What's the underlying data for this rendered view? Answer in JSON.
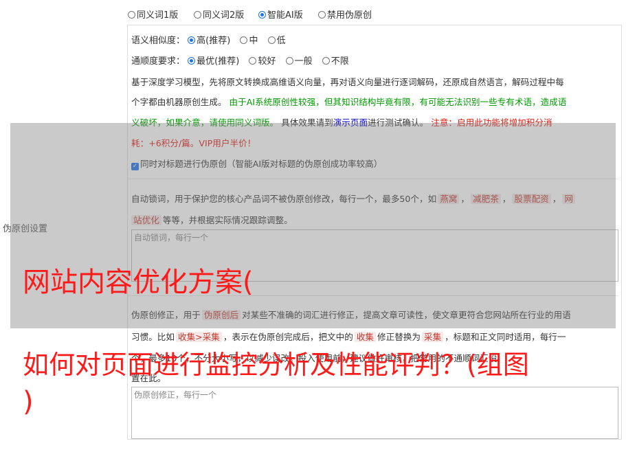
{
  "versions": [
    {
      "label": "同义词1版",
      "selected": false
    },
    {
      "label": "同义词2版",
      "selected": false
    },
    {
      "label": "智能AI版",
      "selected": true
    },
    {
      "label": "禁用伪原创",
      "selected": false
    }
  ],
  "side_label": "伪原创设置",
  "similarity": {
    "label": "语义相似度：",
    "options": [
      {
        "label": "高(推荐)",
        "selected": true
      },
      {
        "label": "中",
        "selected": false
      },
      {
        "label": "低",
        "selected": false
      }
    ]
  },
  "fluency": {
    "label": "通顺度要求：",
    "options": [
      {
        "label": "最优(推荐)",
        "selected": true
      },
      {
        "label": "较好",
        "selected": false
      },
      {
        "label": "一般",
        "selected": false
      },
      {
        "label": "不限",
        "selected": false
      }
    ]
  },
  "desc": {
    "l1": "基于深度学习模型，先将原文转换成高维语义向量，再对语义向量进行逐词解码，还原成自然语言，解码过程中每",
    "l2a": "个字都由机器原创生成。",
    "l2b": "由于AI系统原创性较强，但其知识结构毕竟有限，有可能无法识别一些专有术语，造成语",
    "l3a": "义破坏，如果介意，请使用同义词版。",
    "l3b": "具体效果请到",
    "l3c": "演示页面",
    "l3d": "进行测试确认。",
    "l3e": "注意：启用此功能将增加积分消",
    "l4": "耗：+6积分/篇。VIP用户半价！"
  },
  "title_check": {
    "label": "同时对标题进行伪原创（智能AI版对标题的伪原创成功率较高）",
    "checked": true
  },
  "lock": {
    "l1a": "自动锁词，用于保护您的核心产品词不被伪原创修改，每行一个，最多50个，如",
    "tags": [
      "燕窝",
      "减肥茶",
      "股票配资",
      "网"
    ],
    "l2tag": "站优化",
    "l2b": "等等，并根据实际情况跟踪调整。",
    "placeholder": "自动锁词，每行一个"
  },
  "fix": {
    "l1a": "伪原创修正，用于",
    "l1tag": "伪原创后",
    "l1b": "对某些不准确的词汇进行修正，提高文章可读性，使文章更符合您网站所在行业的用语",
    "l2a": "习惯。比如",
    "l2tag1": "收集>采集",
    "l2b": "，表示在伪原创完成后，把文中的",
    "l2tag2": "收集",
    "l2c": "修正替换为",
    "l2tag3": "采集",
    "l2d": "，标题和正文同时适用，每行一",
    "l3": "个，最多10个，不分大小写，以减少误改。投入使用前，建议做好审核，把常用的不通顺词汇设",
    "l4": "置在此。",
    "placeholder": "伪原创修正，每行一个"
  },
  "overlay_title_1": "网站内容优化方案(",
  "overlay_title_2": "如何对页面进行监控分析及性能评判？(组图",
  "overlay_title_3": ")"
}
